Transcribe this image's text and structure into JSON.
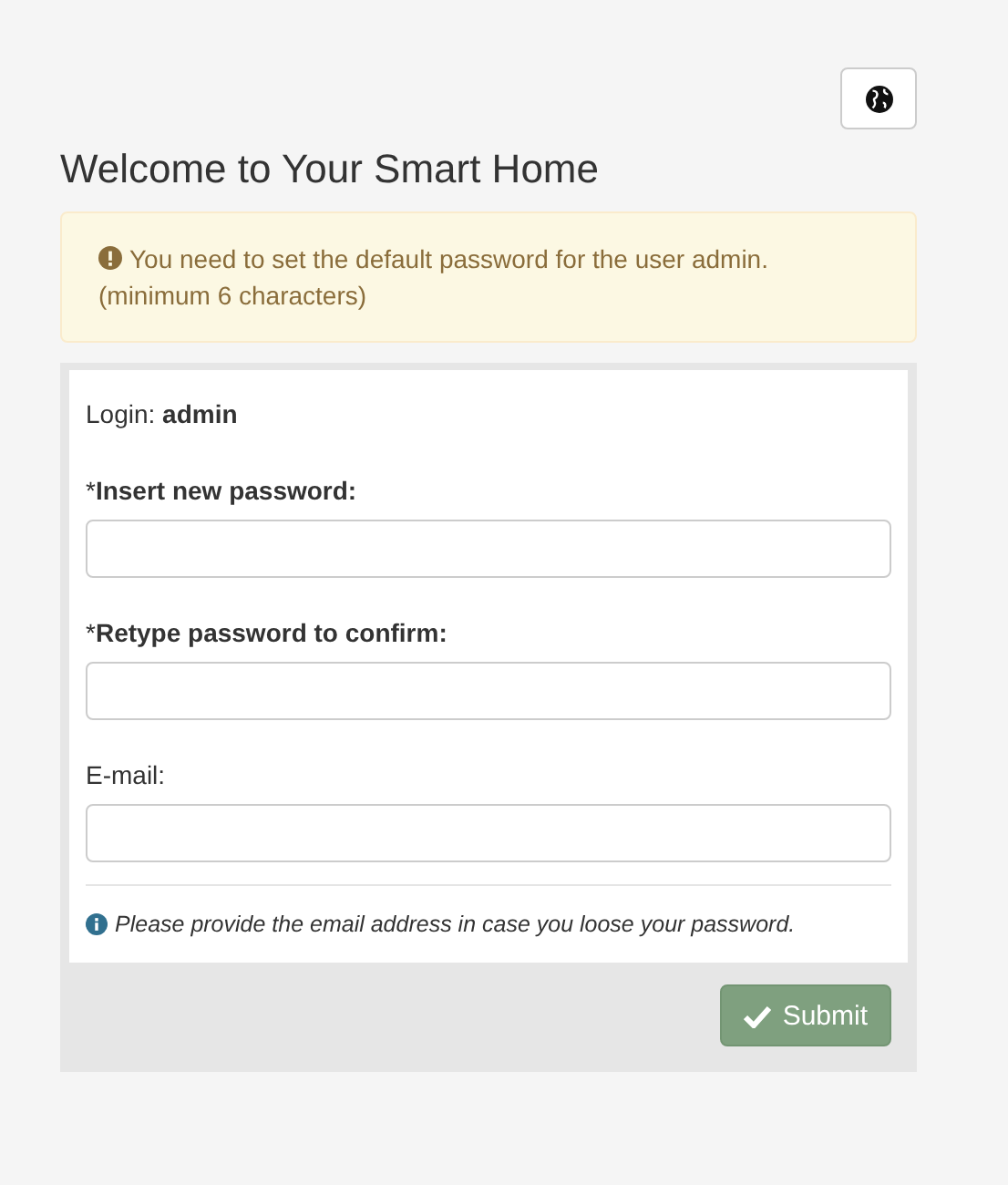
{
  "title": "Welcome to Your Smart Home",
  "alert": {
    "lines": [
      "You need to set the default password for the user admin.",
      "(minimum 6 characters)"
    ]
  },
  "login": "Login: **admin**",
  "fields": [
    {
      "label": "*​**Insert new password:**"
    },
    {
      "label": "*​**Retype password to confirm:**"
    },
    {
      "label": "E-mail:"
    }
  ],
  "hint": "Please provide the email address in case you loose your password.",
  "submit": "Submit"
}
